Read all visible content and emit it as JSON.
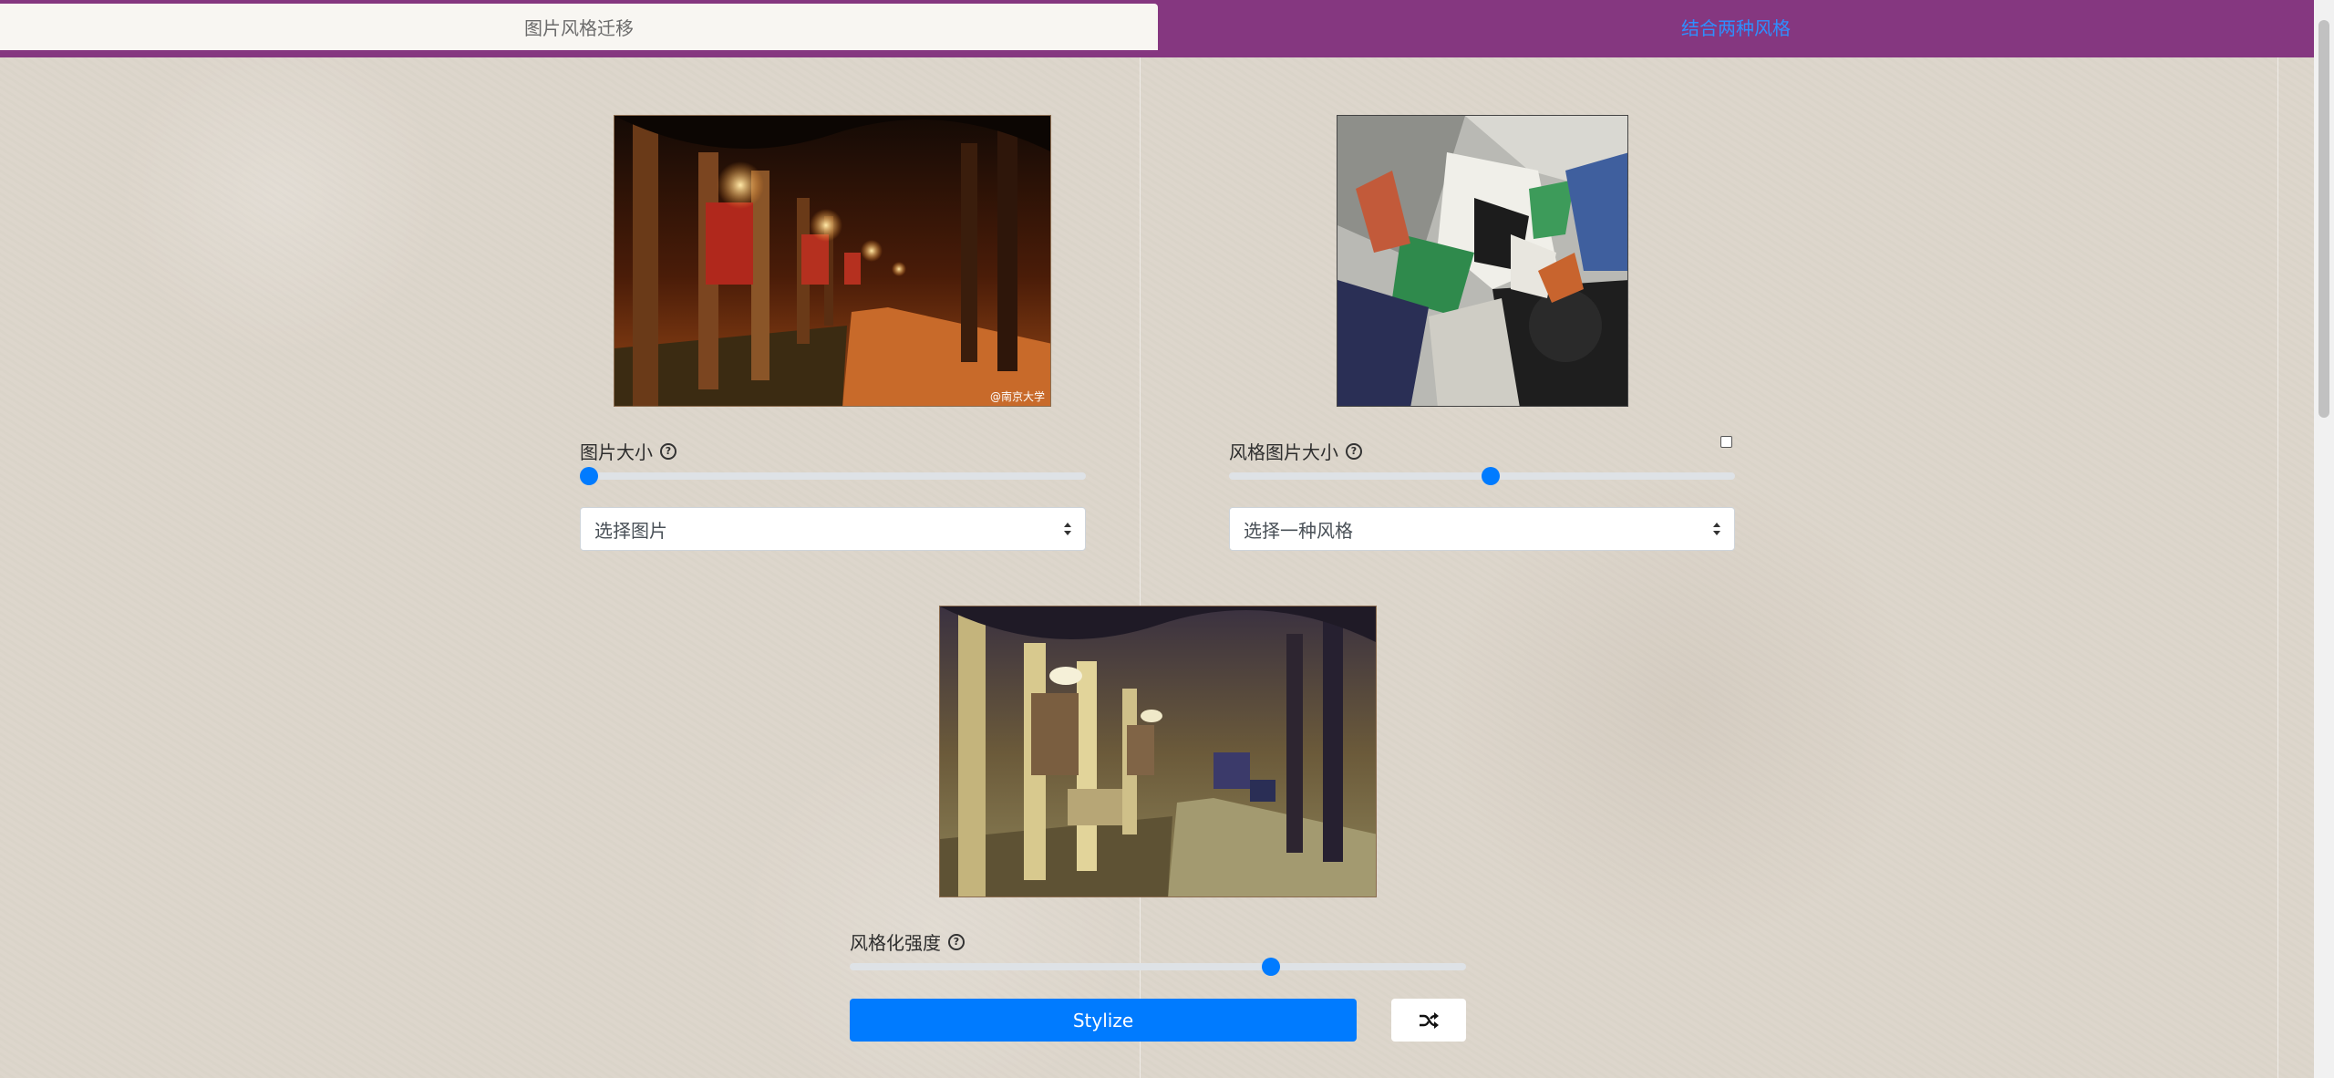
{
  "tabs": [
    {
      "label": "图片风格迁移",
      "active": true
    },
    {
      "label": "结合两种风格",
      "active": false
    }
  ],
  "content_panel": {
    "watermark": "@南京大学",
    "size_label": "图片大小",
    "size_slider_value": 0.0,
    "select_placeholder": "选择图片"
  },
  "style_panel": {
    "size_label": "风格图片大小",
    "size_slider_value": 0.52,
    "checkbox_checked": false,
    "select_placeholder": "选择一种风格"
  },
  "stylize": {
    "strength_label": "风格化强度",
    "strength_slider_value": 0.68,
    "button_label": "Stylize",
    "random_icon": "shuffle-icon"
  },
  "colors": {
    "tab_bar": "#853780",
    "active_tab_bg": "#f8f6f2",
    "inactive_tab_text": "#2e8fff",
    "accent": "#007bff"
  }
}
